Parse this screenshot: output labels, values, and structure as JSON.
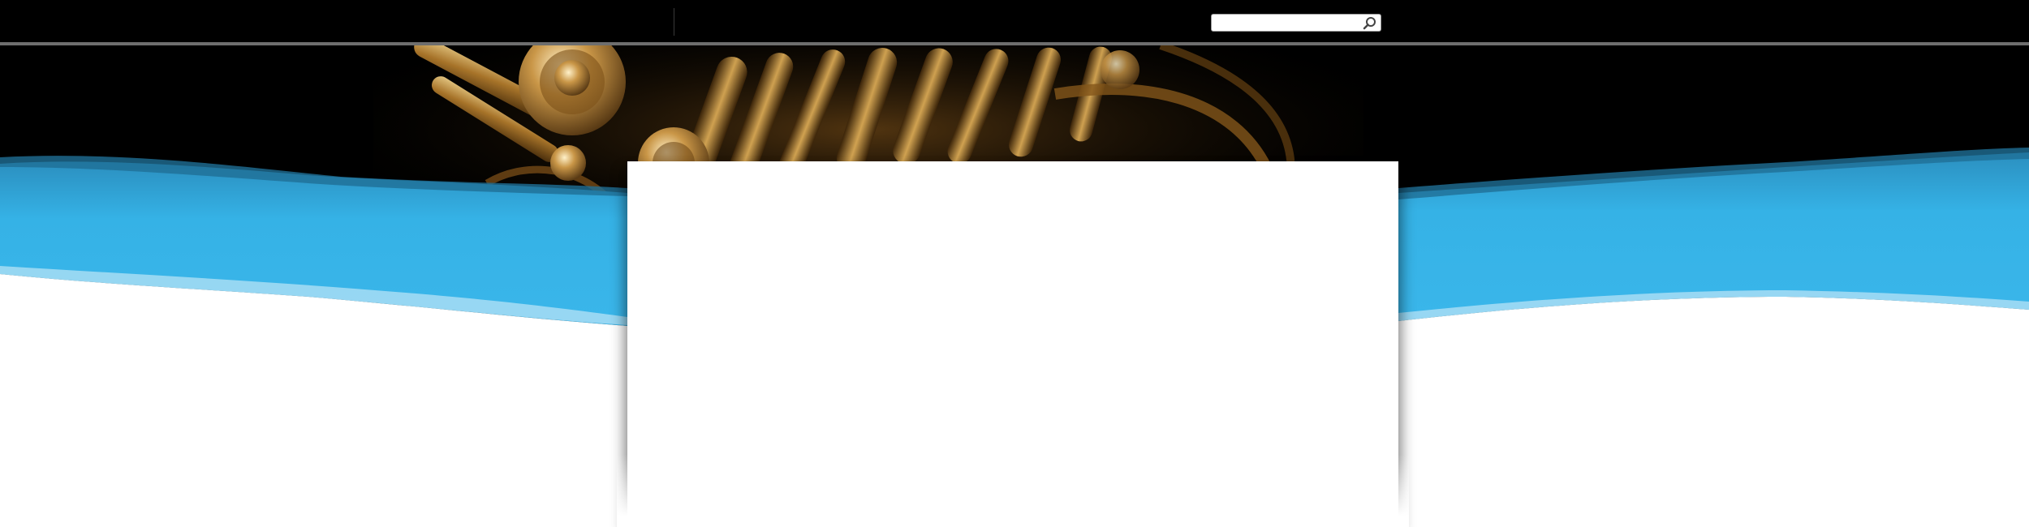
{
  "header": {
    "search": {
      "placeholder": "",
      "value": "",
      "icon": "search-icon"
    }
  },
  "hero": {
    "image": "saxophone-keys-photo",
    "accent_color": "#35b2e6",
    "background_color": "#000000"
  },
  "content": {
    "background_color": "#ffffff"
  }
}
